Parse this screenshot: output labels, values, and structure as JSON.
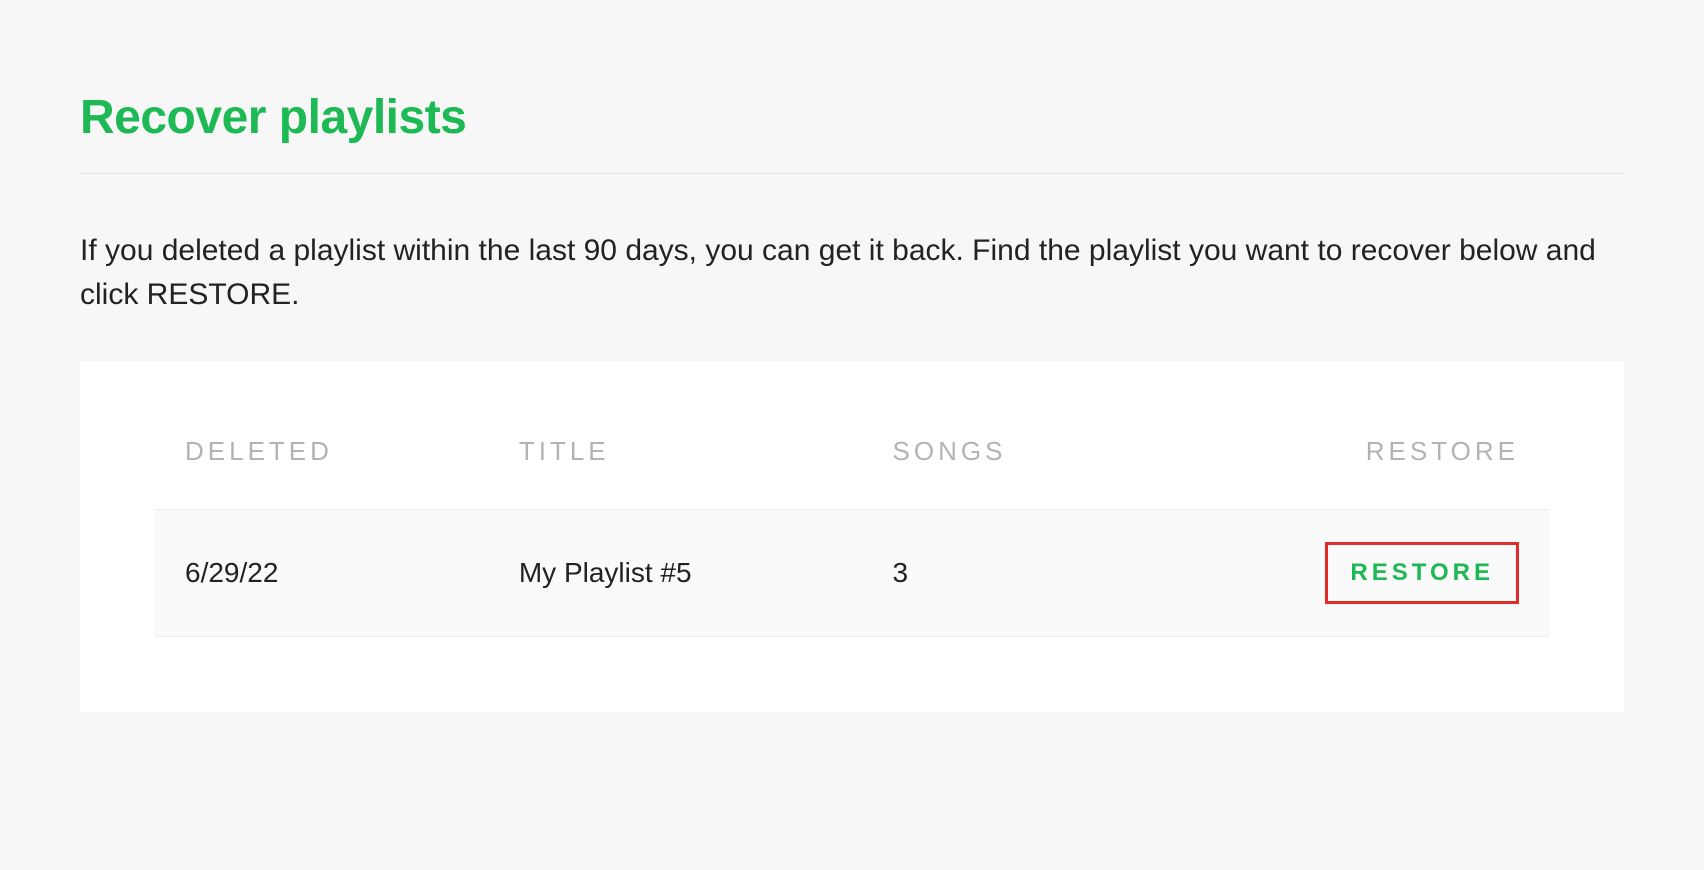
{
  "page": {
    "title": "Recover playlists",
    "description": "If you deleted a playlist within the last 90 days, you can get it back. Find the playlist you want to recover below and click RESTORE."
  },
  "table": {
    "headers": {
      "deleted": "DELETED",
      "title": "TITLE",
      "songs": "SONGS",
      "restore": "RESTORE"
    },
    "rows": [
      {
        "deleted": "6/29/22",
        "title": "My Playlist #5",
        "songs": "3",
        "restore_label": "RESTORE"
      }
    ]
  }
}
